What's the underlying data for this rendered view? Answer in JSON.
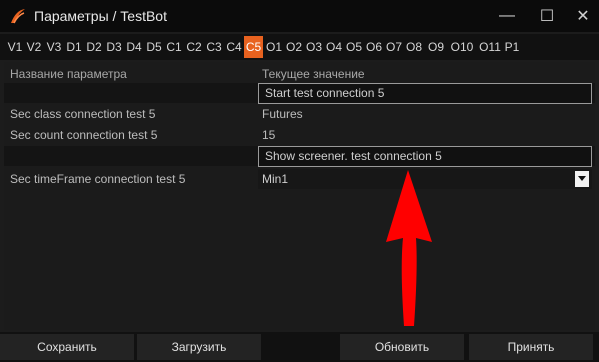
{
  "window": {
    "title": "Параметры / TestBot",
    "minimize_glyph": "—",
    "maximize_glyph": "☐",
    "close_glyph": "✕"
  },
  "tabs": [
    {
      "label": "V1"
    },
    {
      "label": "V2"
    },
    {
      "label": "V3"
    },
    {
      "label": "D1"
    },
    {
      "label": "D2"
    },
    {
      "label": "D3"
    },
    {
      "label": "D4"
    },
    {
      "label": "D5"
    },
    {
      "label": "C1"
    },
    {
      "label": "C2"
    },
    {
      "label": "C3"
    },
    {
      "label": "C4"
    },
    {
      "label": "C5",
      "active": true
    },
    {
      "label": "O1"
    },
    {
      "label": "O2"
    },
    {
      "label": "O3"
    },
    {
      "label": "O4"
    },
    {
      "label": "O5"
    },
    {
      "label": "O6"
    },
    {
      "label": "O7"
    },
    {
      "label": "O8"
    },
    {
      "label": "O9"
    },
    {
      "label": "O10"
    },
    {
      "label": "O11"
    },
    {
      "label": "P1"
    }
  ],
  "grid": {
    "header_name": "Название параметра",
    "header_value": "Текущее значение",
    "start_button": "Start test connection 5",
    "sec_class_name": "Sec class connection test 5",
    "sec_class_value": "Futures",
    "sec_count_name": "Sec count connection test 5",
    "sec_count_value": "15",
    "screener_button": "Show screener. test connection 5",
    "timeframe_name": "Sec timeFrame connection test 5",
    "timeframe_value": "Min1"
  },
  "buttons": {
    "save": "Сохранить",
    "load": "Загрузить",
    "refresh": "Обновить",
    "accept": "Принять"
  },
  "colors": {
    "active_tab": "#e8621f",
    "annotation_arrow": "#ff0000"
  }
}
